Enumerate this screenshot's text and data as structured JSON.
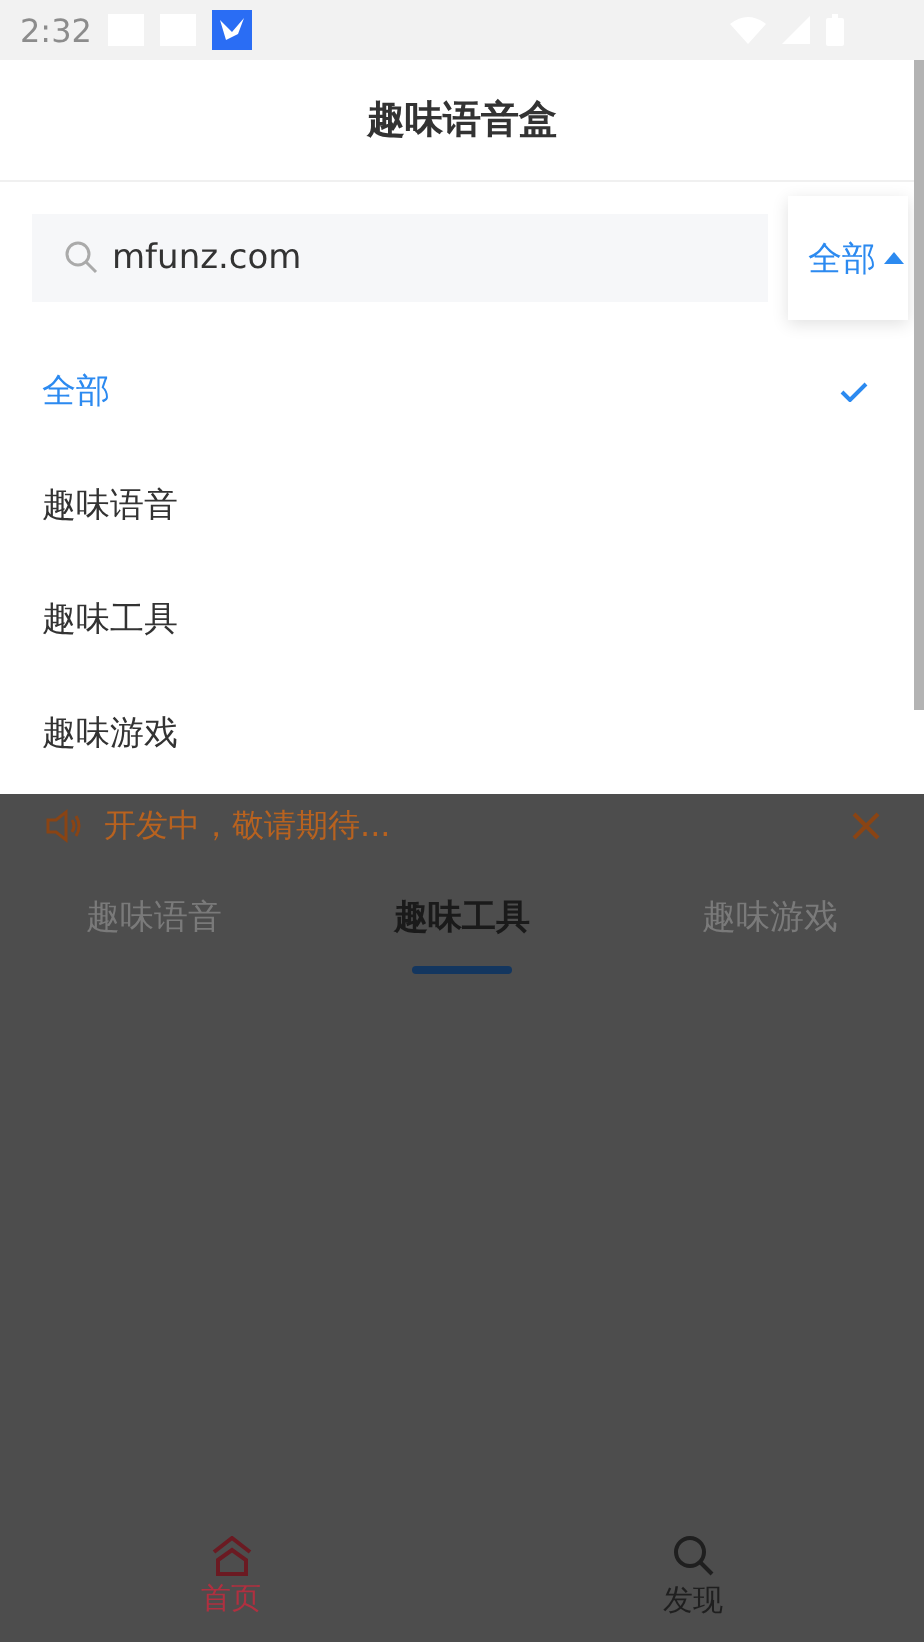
{
  "status_bar": {
    "time": "2:32"
  },
  "header": {
    "title": "趣味语音盒"
  },
  "search": {
    "value": "mfunz.com"
  },
  "dropdown": {
    "label": "全部",
    "expanded": true,
    "options": [
      {
        "label": "全部",
        "selected": true
      },
      {
        "label": "趣味语音",
        "selected": false
      },
      {
        "label": "趣味工具",
        "selected": false
      },
      {
        "label": "趣味游戏",
        "selected": false
      }
    ]
  },
  "notice": {
    "text": "开发中，敬请期待..."
  },
  "tabs": [
    {
      "label": "趣味语音",
      "selected": false
    },
    {
      "label": "趣味工具",
      "selected": true
    },
    {
      "label": "趣味游戏",
      "selected": false
    }
  ],
  "bottom_nav": [
    {
      "label": "首页",
      "kind": "home",
      "selected": true
    },
    {
      "label": "发现",
      "kind": "discover",
      "selected": false
    }
  ]
}
